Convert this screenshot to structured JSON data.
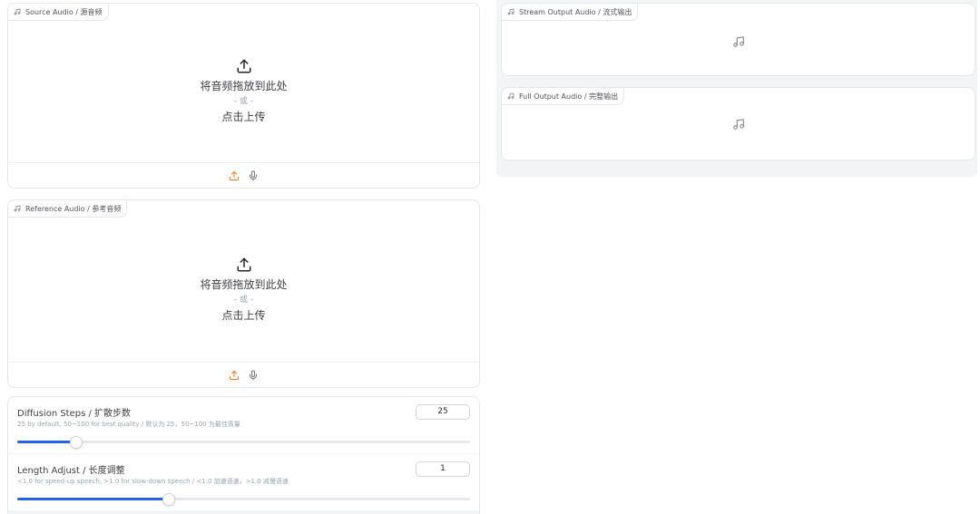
{
  "source_audio": {
    "label": "Source Audio / 源音频",
    "drop_text": "将音频拖放到此处",
    "or_text": "- 或 -",
    "click_text": "点击上传",
    "icons": [
      "music-note-icon",
      "upload-icon",
      "microphone-icon"
    ]
  },
  "reference_audio": {
    "label": "Reference Audio / 参考音频",
    "drop_text": "将音频拖放到此处",
    "or_text": "- 或 -",
    "click_text": "点击上传"
  },
  "stream_output": {
    "label": "Stream Output Audio / 流式输出"
  },
  "full_output": {
    "label": "Full Output Audio / 完整输出"
  },
  "diffusion_steps": {
    "title": "Diffusion Steps / 扩散步数",
    "info": "25 by default, 50~100 for best quality / 默认为 25，50~100 为最佳质量",
    "value": "25",
    "fraction": 0.13
  },
  "length_adjust": {
    "title": "Length Adjust / 长度调整",
    "info": "<1.0 for speed-up speech, >1.0 for slow-down speech / <1.0 加速语速，>1.0 减慢语速",
    "value": "1",
    "fraction": 0.335
  },
  "colors": {
    "accent_orange": "#f97316",
    "slider_blue": "#2563eb",
    "border": "#e5e7eb"
  }
}
